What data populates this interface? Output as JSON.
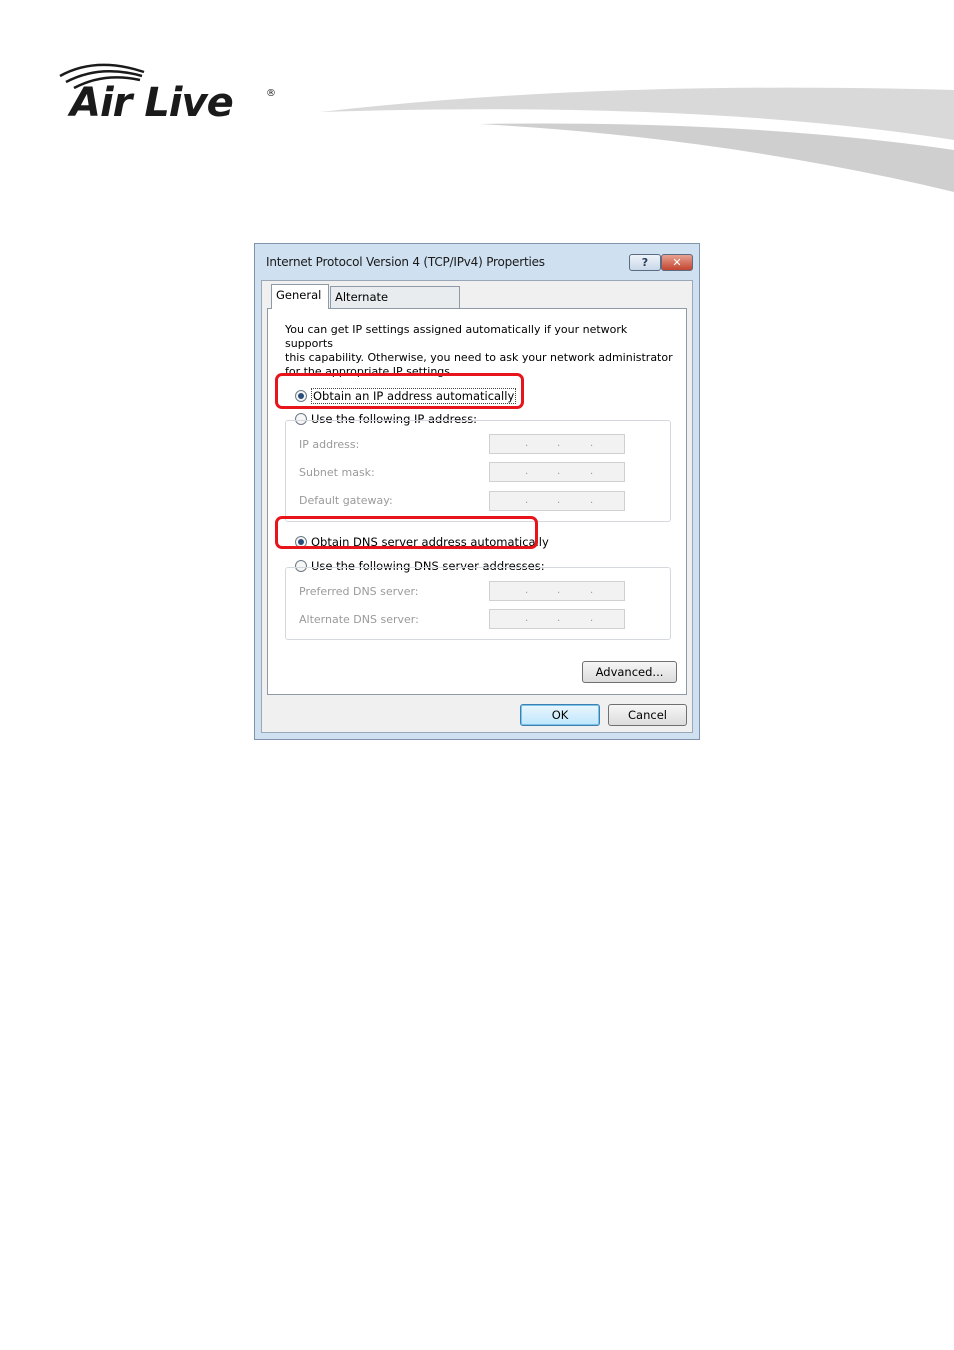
{
  "header": {
    "logo_text": "Air Live",
    "logo_reg": "®"
  },
  "dialog": {
    "title": "Internet Protocol Version 4 (TCP/IPv4) Properties",
    "help_label": "?",
    "close_label": "✕",
    "tabs": [
      {
        "label": "General",
        "selected": true
      },
      {
        "label": "Alternate Configuration",
        "selected": false
      }
    ],
    "description": "You can get IP settings assigned automatically if your network supports\nthis capability. Otherwise, you need to ask your network administrator\nfor the appropriate IP settings.",
    "ip": {
      "auto_label": "Obtain an IP address automatically",
      "manual_label": "Use the following IP address:",
      "selected": "auto",
      "fields": [
        {
          "label": "IP address:",
          "value": ". . ."
        },
        {
          "label": "Subnet mask:",
          "value": ". . ."
        },
        {
          "label": "Default gateway:",
          "value": ". . ."
        }
      ]
    },
    "dns": {
      "auto_label": "Obtain DNS server address automatically",
      "manual_label": "Use the following DNS server addresses:",
      "selected": "auto",
      "fields": [
        {
          "label": "Preferred DNS server:",
          "value": ". . ."
        },
        {
          "label": "Alternate DNS server:",
          "value": ". . ."
        }
      ]
    },
    "advanced_label": "Advanced...",
    "ok_label": "OK",
    "cancel_label": "Cancel"
  },
  "colors": {
    "highlight": "#e8141c",
    "dialog_frame": "#cfe0f1"
  }
}
